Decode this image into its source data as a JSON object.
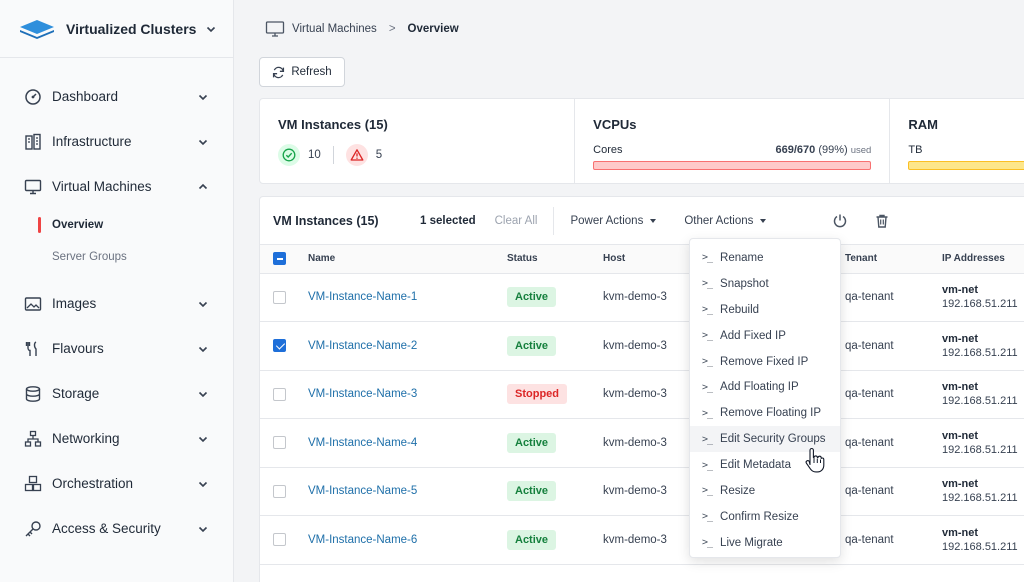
{
  "sidebar": {
    "brand": "Virtualized Clusters",
    "items": [
      {
        "label": "Dashboard",
        "icon": "dashboard-icon"
      },
      {
        "label": "Infrastructure",
        "icon": "infrastructure-icon"
      },
      {
        "label": "Virtual Machines",
        "icon": "monitor-icon",
        "expanded": true,
        "children": [
          {
            "label": "Overview",
            "active": true
          },
          {
            "label": "Server Groups"
          }
        ]
      },
      {
        "label": "Images",
        "icon": "images-icon"
      },
      {
        "label": "Flavours",
        "icon": "flavours-icon"
      },
      {
        "label": "Storage",
        "icon": "storage-icon"
      },
      {
        "label": "Networking",
        "icon": "networking-icon"
      },
      {
        "label": "Orchestration",
        "icon": "orchestration-icon"
      },
      {
        "label": "Access & Security",
        "icon": "key-icon"
      }
    ]
  },
  "breadcrumb": {
    "parent": "Virtual Machines",
    "separator": ">",
    "current": "Overview"
  },
  "refresh_label": "Refresh",
  "stats": {
    "instances": {
      "title": "VM Instances (15)",
      "ok_count": "10",
      "warn_count": "5"
    },
    "vcpus": {
      "title": "VCPUs",
      "label": "Cores",
      "used": "669/670",
      "pct": "(99%)",
      "used_word": "used",
      "fill": 0.99,
      "color": "#fecaca",
      "border": "#f87171"
    },
    "ram": {
      "title": "RAM",
      "label": "TB",
      "color": "#fde68a",
      "border": "#fbbf24"
    }
  },
  "toolbar": {
    "title": "VM Instances (15)",
    "selected": "1 selected",
    "clear": "Clear All",
    "power_actions": "Power Actions",
    "other_actions": "Other Actions"
  },
  "table": {
    "headers": {
      "name": "Name",
      "status": "Status",
      "host": "Host",
      "tenant": "Tenant",
      "ip": "IP Addresses"
    },
    "rows": [
      {
        "name": "VM-Instance-Name-1",
        "status": "Active",
        "host": "kvm-demo-3",
        "tenant": "qa-tenant",
        "net": "vm-net",
        "ip": "192.168.51.211",
        "checked": false
      },
      {
        "name": "VM-Instance-Name-2",
        "status": "Active",
        "host": "kvm-demo-3",
        "tenant": "qa-tenant",
        "net": "vm-net",
        "ip": "192.168.51.211",
        "checked": true
      },
      {
        "name": "VM-Instance-Name-3",
        "status": "Stopped",
        "host": "kvm-demo-3",
        "tenant": "qa-tenant",
        "net": "vm-net",
        "ip": "192.168.51.211",
        "checked": false
      },
      {
        "name": "VM-Instance-Name-4",
        "status": "Active",
        "host": "kvm-demo-3",
        "tenant": "qa-tenant",
        "net": "vm-net",
        "ip": "192.168.51.211",
        "checked": false
      },
      {
        "name": "VM-Instance-Name-5",
        "status": "Active",
        "host": "kvm-demo-3",
        "tenant": "qa-tenant",
        "net": "vm-net",
        "ip": "192.168.51.211",
        "checked": false
      },
      {
        "name": "VM-Instance-Name-6",
        "status": "Active",
        "host": "kvm-demo-3",
        "tenant": "qa-tenant",
        "net": "vm-net",
        "ip": "192.168.51.211",
        "checked": false
      }
    ]
  },
  "dropdown": {
    "prompt": ">_",
    "items": [
      "Rename",
      "Snapshot",
      "Rebuild",
      "Add Fixed IP",
      "Remove Fixed IP",
      "Add Floating IP",
      "Remove Floating IP",
      "Edit Security Groups",
      "Edit Metadata",
      "Resize",
      "Confirm Resize",
      "Live Migrate"
    ],
    "hover_index": 7
  },
  "colors": {
    "accent": "#1e6fd9",
    "link": "#1e6fa9",
    "active_bar": "#ef4444"
  }
}
